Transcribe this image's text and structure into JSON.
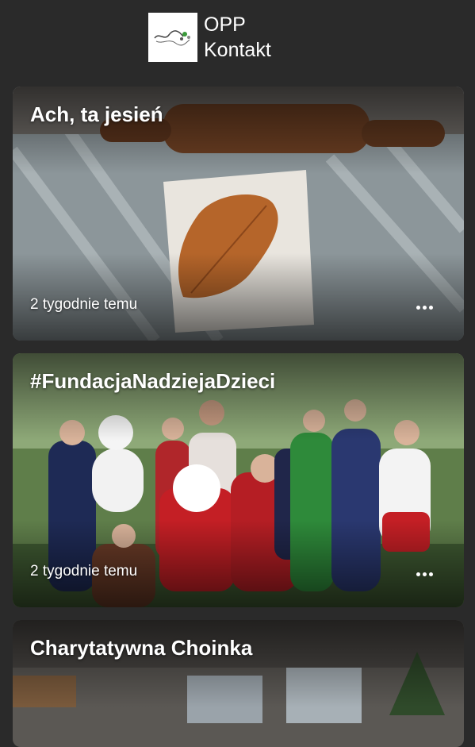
{
  "header": {
    "title_line1": "OPP",
    "title_line2": "Kontakt",
    "logo_icon": "organization-logo"
  },
  "posts": [
    {
      "title": "Ach, ta jesień",
      "time": "2 tygodnie temu",
      "menu_icon": "more-dots-icon"
    },
    {
      "title": "#FundacjaNadziejaDzieci",
      "time": "2 tygodnie temu",
      "menu_icon": "more-dots-icon"
    },
    {
      "title": "Charytatywna Choinka"
    }
  ],
  "colors": {
    "background": "#2a2a2a",
    "text": "#ffffff"
  }
}
